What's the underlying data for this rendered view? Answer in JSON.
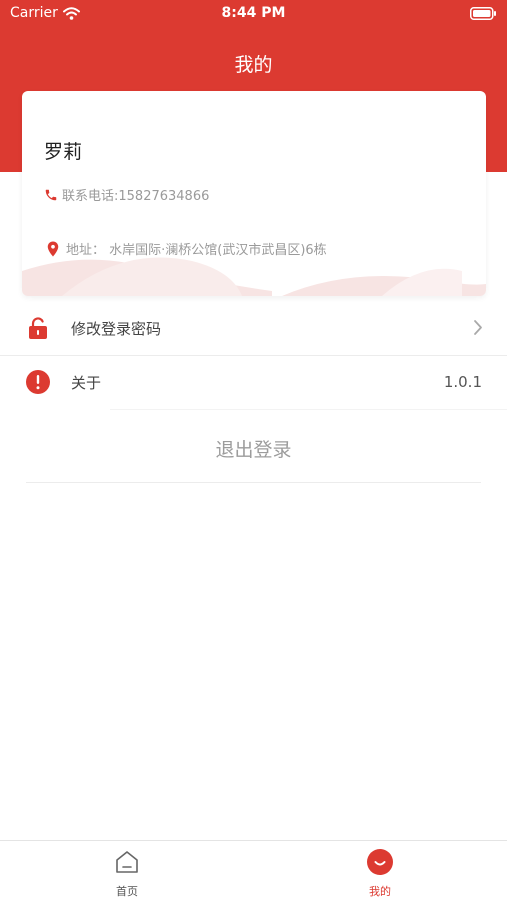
{
  "status_bar": {
    "carrier": "Carrier",
    "time": "8:44 PM"
  },
  "nav": {
    "title": "我的"
  },
  "profile": {
    "name": "罗莉",
    "phone": "联系电话:15827634866",
    "address": "地址：  水岸国际·澜桥公馆(武汉市武昌区)6栋"
  },
  "menu": {
    "change_password": "修改登录密码",
    "about": "关于",
    "version": "1.0.1"
  },
  "logout_label": "退出登录",
  "tab_bar": {
    "home": "首页",
    "mine": "我的"
  },
  "colors": {
    "brand": "#dc3a31",
    "text": "#333333",
    "muted": "#9a9a9a"
  },
  "icons": {
    "status": [
      "wifi-icon",
      "battery-icon"
    ],
    "profile": [
      "phone-icon",
      "location-pin-icon"
    ],
    "menu": [
      "lock-icon",
      "info-icon",
      "chevron-right-icon"
    ],
    "tabs": [
      "home-icon",
      "mine-smile-icon"
    ]
  }
}
